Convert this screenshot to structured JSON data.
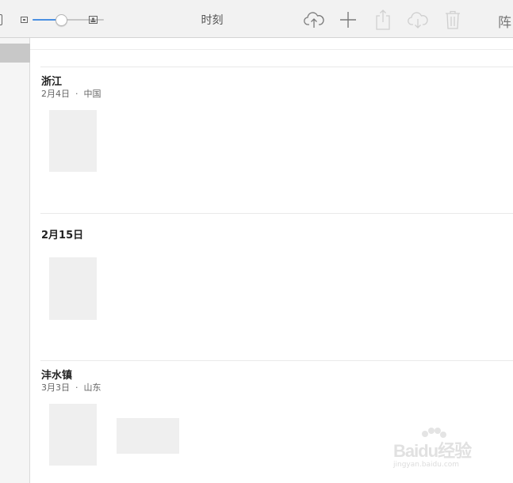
{
  "toolbar": {
    "title": "时刻",
    "cut_label": "阵",
    "zoom_level": 0.4,
    "icons": [
      "sidebar-toggle-icon",
      "small-photo-icon",
      "large-photo-icon",
      "cloud-upload-icon",
      "plus-icon",
      "share-icon",
      "cloud-download-icon",
      "trash-icon"
    ]
  },
  "moments": [
    {
      "title": "浙江",
      "subtitle": "2月4日  ·  中国"
    },
    {
      "title": "2月15日",
      "subtitle": ""
    },
    {
      "title": "沣水镇",
      "subtitle": "3月3日  ·  山东"
    }
  ],
  "watermark": {
    "brand": "Baidu经验",
    "url": "jingyan.baidu.com"
  },
  "colors": {
    "accent": "#4a90e2",
    "toolbar_bg": "#f2f2f2",
    "placeholder": "#efefef"
  }
}
